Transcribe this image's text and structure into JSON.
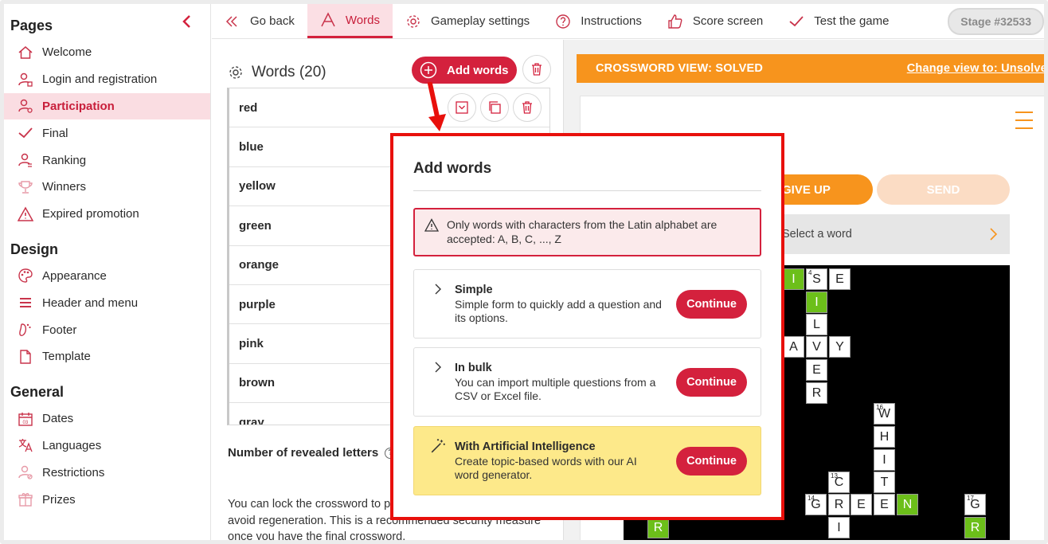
{
  "sidebar": {
    "sections": [
      {
        "title": "Pages",
        "items": [
          {
            "label": "Welcome",
            "icon": "home-icon"
          },
          {
            "label": "Login and registration",
            "icon": "user-lock-icon"
          },
          {
            "label": "Participation",
            "icon": "user-gear-icon",
            "active": true
          },
          {
            "label": "Final",
            "icon": "check-icon"
          },
          {
            "label": "Ranking",
            "icon": "ranking-icon"
          },
          {
            "label": "Winners",
            "icon": "trophy-icon"
          },
          {
            "label": "Expired promotion",
            "icon": "warning-icon"
          }
        ]
      },
      {
        "title": "Design",
        "items": [
          {
            "label": "Appearance",
            "icon": "palette-icon"
          },
          {
            "label": "Header and menu",
            "icon": "menu-icon"
          },
          {
            "label": "Footer",
            "icon": "footer-icon"
          },
          {
            "label": "Template",
            "icon": "document-icon"
          }
        ]
      },
      {
        "title": "General",
        "items": [
          {
            "label": "Dates",
            "icon": "calendar-icon"
          },
          {
            "label": "Languages",
            "icon": "translate-icon"
          },
          {
            "label": "Restrictions",
            "icon": "restrictions-icon"
          },
          {
            "label": "Prizes",
            "icon": "gift-icon"
          }
        ]
      }
    ]
  },
  "topbar": {
    "tabs": [
      {
        "label": "Go back",
        "icon": "double-chevron-left-icon"
      },
      {
        "label": "Words",
        "icon": "letter-a-icon",
        "active": true
      },
      {
        "label": "Gameplay settings",
        "icon": "gear-icon"
      },
      {
        "label": "Instructions",
        "icon": "question-icon"
      },
      {
        "label": "Score screen",
        "icon": "thumbs-up-icon"
      },
      {
        "label": "Test the game",
        "icon": "check-icon"
      }
    ],
    "stage": "Stage #32533"
  },
  "words": {
    "title": "Words (20)",
    "add_label": "Add words",
    "list": [
      "red",
      "blue",
      "yellow",
      "green",
      "orange",
      "purple",
      "pink",
      "brown",
      "gray"
    ],
    "revealed_label": "Number of revealed letters",
    "lock_text": "You can lock the crossword to prevent it from changing and avoid regeneration. This is a recommended security measure once you have the final crossword."
  },
  "preview": {
    "banner": "CROSSWORD VIEW: SOLVED",
    "change_view": "Change view to: Unsolved",
    "give_up": "GIVE UP",
    "send": "SEND",
    "select_word": "Select a word",
    "cells": [
      {
        "l": "I",
        "g": true
      },
      {
        "l": "S",
        "n": "4"
      },
      {
        "l": "E"
      },
      {
        "l": "I",
        "g": true
      },
      {
        "l": "L"
      },
      {
        "l": "A"
      },
      {
        "l": "V"
      },
      {
        "l": "Y"
      },
      {
        "l": "E"
      },
      {
        "l": "R"
      },
      {
        "l": "W",
        "n": "16"
      },
      {
        "l": "H"
      },
      {
        "l": "I"
      },
      {
        "l": "T"
      },
      {
        "l": "C",
        "n": "13"
      },
      {
        "l": "G",
        "n": "14"
      },
      {
        "l": "R"
      },
      {
        "l": "E"
      },
      {
        "l": "E"
      },
      {
        "l": "N",
        "g": true
      },
      {
        "l": "G",
        "n": "17"
      },
      {
        "l": "R",
        "g": true
      },
      {
        "l": "I"
      },
      {
        "l": "R",
        "g": true
      }
    ]
  },
  "modal": {
    "title": "Add words",
    "alert": "Only words with characters from the Latin alphabet are accepted: A, B, C, ..., Z",
    "options": [
      {
        "title": "Simple",
        "desc": "Simple form to quickly add a question and its options.",
        "button": "Continue"
      },
      {
        "title": "In bulk",
        "desc": "You can import multiple questions from a CSV or Excel file.",
        "button": "Continue"
      },
      {
        "title": "With Artificial Intelligence",
        "desc": "Create topic-based words with our AI word generator.",
        "button": "Continue"
      }
    ]
  },
  "colors": {
    "brand": "#d4213d",
    "orange": "#f7941d",
    "annotation": "#e8100c",
    "ai_option": "#fde98a"
  }
}
